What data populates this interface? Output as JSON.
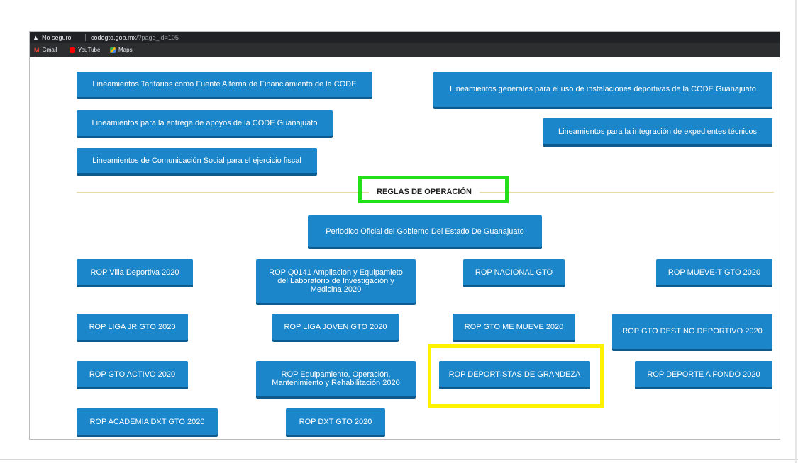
{
  "browser": {
    "warning_icon": "warning-triangle-icon",
    "warning_symbol": "▲",
    "security_label": "No seguro",
    "url_host": "codegto.gob.mx",
    "url_path": "/?page_id=105",
    "bookmarks": [
      {
        "label": "Gmail",
        "icon": "gmail-icon"
      },
      {
        "label": "YouTube",
        "icon": "youtube-icon"
      },
      {
        "label": "Maps",
        "icon": "maps-icon"
      }
    ]
  },
  "lineamientos": [
    "Lineamientos Tarifarios como Fuente Alterna de Financiamiento de la CODE",
    "Lineamientos generales para el uso de instalaciones deportivas de la CODE Guanajuato",
    "Lineamientos para la entrega de apoyos de la CODE Guanajuato",
    "Lineamientos para la integración de expedientes técnicos",
    "Lineamientos de Comunicación Social para el ejercicio fiscal"
  ],
  "section_title": "REGLAS DE OPERACIÓN",
  "periodico": "Periodico Oficial del Gobierno Del Estado De Guanajuato",
  "rop": [
    "ROP Villa Deportiva 2020",
    "ROP Q0141 Ampliación y Equipamieto del Laboratorio de Investigación y Medicina 2020",
    "ROP NACIONAL GTO",
    "ROP MUEVE-T GTO 2020",
    "ROP LIGA JR GTO 2020",
    "ROP LIGA JOVEN GTO 2020",
    "ROP GTO ME MUEVE 2020",
    "ROP GTO DESTINO DEPORTIVO 2020",
    "ROP GTO ACTIVO 2020",
    "ROP Equipamiento, Operación, Mantenimiento y Rehabilitación 2020",
    "ROP DEPORTISTAS DE GRANDEZA",
    "ROP DEPORTE A FONDO 2020",
    "ROP ACADEMIA DXT GTO 2020",
    "ROP DXT GTO 2020"
  ],
  "colors": {
    "button": "#1b86c9",
    "highlight_green": "#22e01a",
    "highlight_yellow": "#fff300"
  }
}
